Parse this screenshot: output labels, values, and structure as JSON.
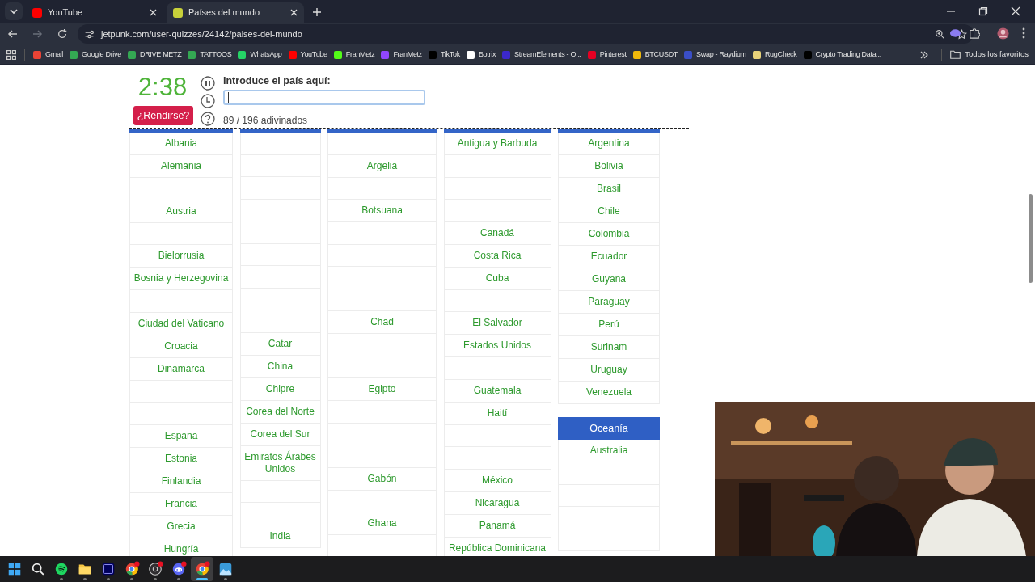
{
  "browser": {
    "tabs": [
      {
        "title": "YouTube",
        "selected": false,
        "color": "#ff0000"
      },
      {
        "title": "Países del mundo",
        "selected": true,
        "color": "#c8d13a"
      }
    ],
    "url": "jetpunk.com/user-quizzes/24142/paises-del-mundo",
    "bookmarks": [
      {
        "label": "Gmail",
        "color": "#ea4335"
      },
      {
        "label": "Google Drive",
        "color": "#34a853"
      },
      {
        "label": "DRIVE METZ",
        "color": "#34a853"
      },
      {
        "label": "TATTOOS",
        "color": "#34a853"
      },
      {
        "label": "WhatsApp",
        "color": "#25d366"
      },
      {
        "label": "YouTube",
        "color": "#ff0000"
      },
      {
        "label": "FranMetz",
        "color": "#53fc18"
      },
      {
        "label": "FranMetz",
        "color": "#9146ff"
      },
      {
        "label": "TikTok",
        "color": "#000000"
      },
      {
        "label": "Botrix",
        "color": "#ffffff"
      },
      {
        "label": "StreamElements - O...",
        "color": "#3b28cc"
      },
      {
        "label": "Pinterest",
        "color": "#e60023"
      },
      {
        "label": "BTCUSDT",
        "color": "#f0b90b"
      },
      {
        "label": "Swap - Raydium",
        "color": "#3a4ec7"
      },
      {
        "label": "RugCheck",
        "color": "#e8d27a"
      },
      {
        "label": "Crypto Trading Data...",
        "color": "#000000"
      }
    ],
    "all_bookmarks": "Todos los favoritos"
  },
  "quiz": {
    "timer": "2:38",
    "give_up": "¿Rendirse?",
    "prompt": "Introduce el país aquí:",
    "progress": "89 / 196 adivinados",
    "columns": [
      {
        "sections": [
          {
            "cells": [
              {
                "kind": "answer",
                "text": "Albania"
              },
              {
                "kind": "answer",
                "text": "Alemania"
              },
              {
                "kind": "blank"
              },
              {
                "kind": "answer",
                "text": "Austria"
              },
              {
                "kind": "blank"
              },
              {
                "kind": "answer",
                "text": "Bielorrusia"
              },
              {
                "kind": "answer",
                "text": "Bosnia y Herzegovina"
              },
              {
                "kind": "blank"
              },
              {
                "kind": "answer",
                "text": "Ciudad del Vaticano"
              },
              {
                "kind": "answer",
                "text": "Croacia"
              },
              {
                "kind": "answer",
                "text": "Dinamarca"
              },
              {
                "kind": "blank"
              },
              {
                "kind": "blank"
              },
              {
                "kind": "answer",
                "text": "España"
              },
              {
                "kind": "answer",
                "text": "Estonia"
              },
              {
                "kind": "answer",
                "text": "Finlandia"
              },
              {
                "kind": "answer",
                "text": "Francia"
              },
              {
                "kind": "answer",
                "text": "Grecia"
              },
              {
                "kind": "answer",
                "text": "Hungría"
              }
            ]
          }
        ]
      },
      {
        "sections": [
          {
            "cells": [
              {
                "kind": "blank"
              },
              {
                "kind": "blank"
              },
              {
                "kind": "blank"
              },
              {
                "kind": "blank"
              },
              {
                "kind": "blank"
              },
              {
                "kind": "blank"
              },
              {
                "kind": "blank"
              },
              {
                "kind": "blank"
              },
              {
                "kind": "blank"
              },
              {
                "kind": "answer",
                "text": "Catar"
              },
              {
                "kind": "answer",
                "text": "China"
              },
              {
                "kind": "answer",
                "text": "Chipre"
              },
              {
                "kind": "answer",
                "text": "Corea del Norte"
              },
              {
                "kind": "answer",
                "text": "Corea del Sur"
              },
              {
                "kind": "answer",
                "text": "Emiratos Árabes Unidos"
              },
              {
                "kind": "blank"
              },
              {
                "kind": "blank"
              },
              {
                "kind": "answer",
                "text": "India"
              }
            ]
          }
        ]
      },
      {
        "sections": [
          {
            "cells": [
              {
                "kind": "blank"
              },
              {
                "kind": "answer",
                "text": "Argelia"
              },
              {
                "kind": "blank"
              },
              {
                "kind": "answer",
                "text": "Botsuana"
              },
              {
                "kind": "blank"
              },
              {
                "kind": "blank"
              },
              {
                "kind": "blank"
              },
              {
                "kind": "blank"
              },
              {
                "kind": "answer",
                "text": "Chad"
              },
              {
                "kind": "blank"
              },
              {
                "kind": "blank"
              },
              {
                "kind": "answer",
                "text": "Egipto"
              },
              {
                "kind": "blank"
              },
              {
                "kind": "blank"
              },
              {
                "kind": "blank"
              },
              {
                "kind": "answer",
                "text": "Gabón"
              },
              {
                "kind": "blank"
              },
              {
                "kind": "answer",
                "text": "Ghana"
              },
              {
                "kind": "blank"
              }
            ]
          }
        ]
      },
      {
        "sections": [
          {
            "cells": [
              {
                "kind": "answer",
                "text": "Antigua y Barbuda"
              },
              {
                "kind": "blank"
              },
              {
                "kind": "blank"
              },
              {
                "kind": "blank"
              },
              {
                "kind": "answer",
                "text": "Canadá"
              },
              {
                "kind": "answer",
                "text": "Costa Rica"
              },
              {
                "kind": "answer",
                "text": "Cuba"
              },
              {
                "kind": "blank"
              },
              {
                "kind": "answer",
                "text": "El Salvador"
              },
              {
                "kind": "answer",
                "text": "Estados Unidos"
              },
              {
                "kind": "blank"
              },
              {
                "kind": "answer",
                "text": "Guatemala"
              },
              {
                "kind": "answer",
                "text": "Haití"
              },
              {
                "kind": "blank"
              },
              {
                "kind": "blank"
              },
              {
                "kind": "answer",
                "text": "México"
              },
              {
                "kind": "answer",
                "text": "Nicaragua"
              },
              {
                "kind": "answer",
                "text": "Panamá"
              },
              {
                "kind": "answer",
                "text": "República Dominicana"
              }
            ]
          }
        ]
      },
      {
        "sections": [
          {
            "cells": [
              {
                "kind": "answer",
                "text": "Argentina"
              },
              {
                "kind": "answer",
                "text": "Bolivia"
              },
              {
                "kind": "answer",
                "text": "Brasil"
              },
              {
                "kind": "answer",
                "text": "Chile"
              },
              {
                "kind": "answer",
                "text": "Colombia"
              },
              {
                "kind": "answer",
                "text": "Ecuador"
              },
              {
                "kind": "answer",
                "text": "Guyana"
              },
              {
                "kind": "answer",
                "text": "Paraguay"
              },
              {
                "kind": "answer",
                "text": "Perú"
              },
              {
                "kind": "answer",
                "text": "Surinam"
              },
              {
                "kind": "answer",
                "text": "Uruguay"
              },
              {
                "kind": "answer",
                "text": "Venezuela"
              }
            ]
          },
          {
            "heading": "Oceanía",
            "cells": [
              {
                "kind": "answer",
                "text": "Australia"
              },
              {
                "kind": "blank"
              },
              {
                "kind": "blank"
              },
              {
                "kind": "blank"
              },
              {
                "kind": "blank"
              }
            ]
          }
        ]
      }
    ]
  },
  "taskbar": [
    {
      "kind": "start",
      "active": false,
      "notification": false
    },
    {
      "kind": "search",
      "active": false,
      "notification": false
    },
    {
      "kind": "music",
      "active": false,
      "notification": false
    },
    {
      "kind": "folder",
      "active": false,
      "notification": false
    },
    {
      "kind": "video-editor",
      "active": false,
      "notification": false
    },
    {
      "kind": "browser",
      "active": false,
      "notification": true
    },
    {
      "kind": "recorder",
      "active": false,
      "notification": true
    },
    {
      "kind": "chat",
      "active": false,
      "notification": true
    },
    {
      "kind": "browser",
      "active": true,
      "notification": true
    },
    {
      "kind": "photos",
      "active": false,
      "notification": false
    }
  ]
}
